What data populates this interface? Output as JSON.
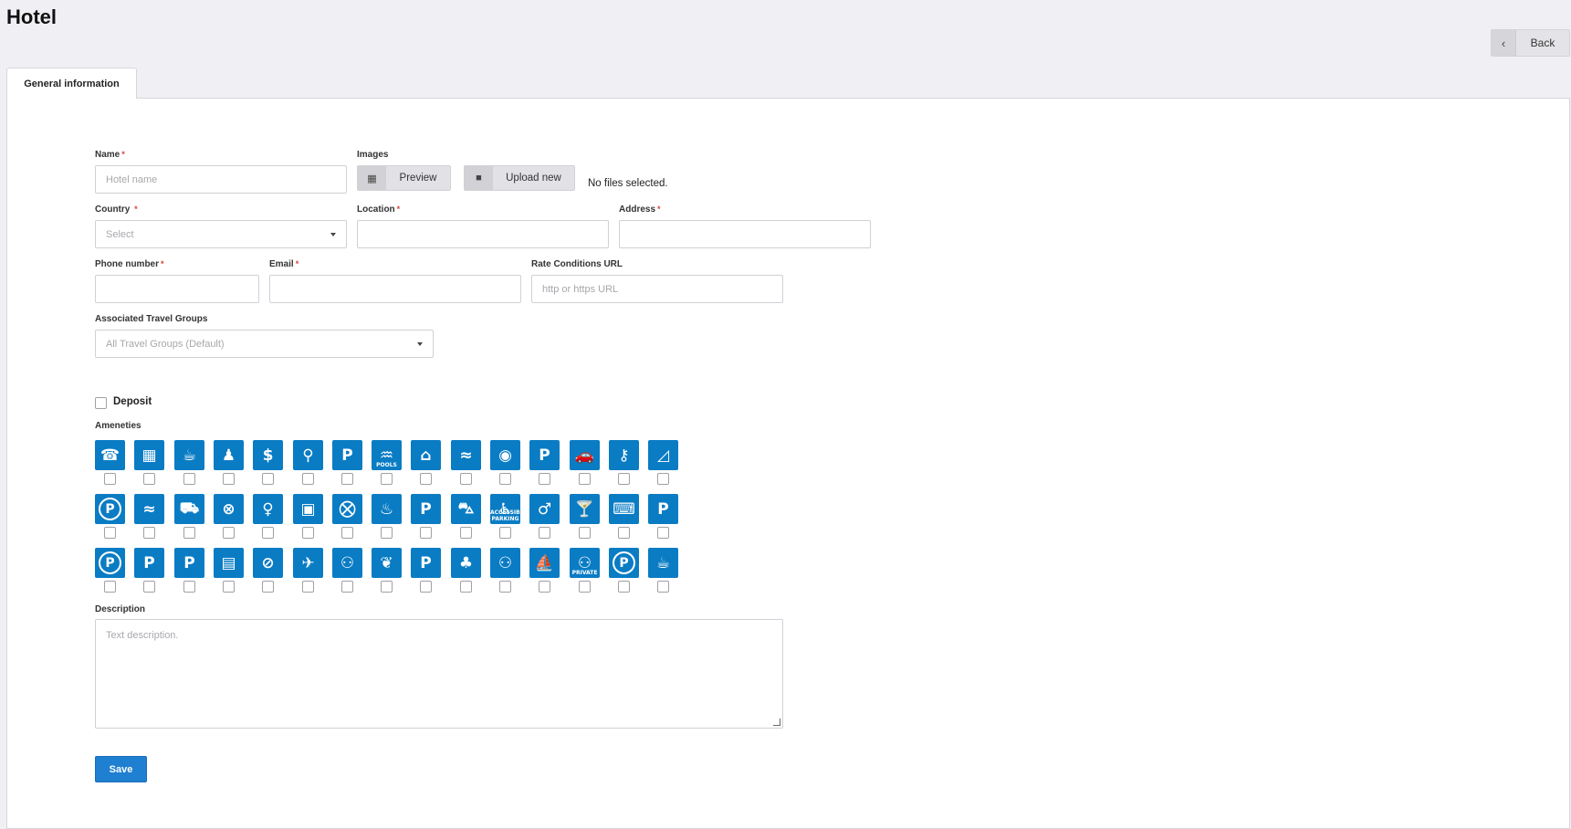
{
  "page": {
    "title": "Hotel",
    "back_label": "Back"
  },
  "tabs": [
    {
      "label": "General information"
    }
  ],
  "form": {
    "name": {
      "label": "Name",
      "required": "*",
      "placeholder": "Hotel name"
    },
    "images": {
      "label": "Images",
      "preview_label": "Preview",
      "upload_label": "Upload new",
      "status": "No files selected."
    },
    "country": {
      "label": "Country",
      "required": "*",
      "placeholder": "Select"
    },
    "location": {
      "label": "Location",
      "required": "*"
    },
    "address": {
      "label": "Address",
      "required": "*"
    },
    "phone": {
      "label": "Phone number",
      "required": "*"
    },
    "email": {
      "label": "Email",
      "required": "*"
    },
    "rate_url": {
      "label": "Rate Conditions URL",
      "placeholder": "http or https URL"
    },
    "travel_groups": {
      "label": "Associated Travel Groups",
      "value": "All Travel Groups (Default)"
    },
    "deposit": {
      "label": "Deposit",
      "checked": false
    },
    "amenities": {
      "label": "Ameneties",
      "color": "#0a7cc4",
      "icons": [
        "room-service-icon",
        "crib-icon",
        "hot-drink-icon",
        "meeting-room-icon",
        "currency-exchange-icon",
        "concierge-icon",
        "paid-parking-icon",
        "pools-icon",
        "garage-icon",
        "swimming-icon",
        "laundry-icon",
        "parking-sign-icon",
        "parking-car-icon",
        "car-key-icon",
        "beach-icon",
        "parking-circle-icon",
        "swimming-pool-icon",
        "delivery-truck-icon",
        "restaurant-icon",
        "housekeeping-icon",
        "safe-icon",
        "shopping-icon",
        "sunbathing-icon",
        "truck-parking-icon",
        "car-service-icon",
        "accessible-parking-icon",
        "doorman-icon",
        "bar-icon",
        "wifi-laptop-icon",
        "airport-parking-icon",
        "parking-circle-alt-icon",
        "parking-arrows-icon",
        "motorcycle-parking-icon",
        "bus-icon",
        "no-smoking-icon",
        "airport-shuttle-icon",
        "family-icon",
        "pet-friendly-icon",
        "valet-parking-icon",
        "tropical-icon",
        "couple-icon",
        "beach-waves-icon",
        "private-restroom-icon",
        "parking-outline-icon",
        "coffee-icon"
      ],
      "glyphs": [
        "☎",
        "▦",
        "☕",
        "♟",
        "$",
        "⚲",
        "P",
        "♒",
        "⌂",
        "≈",
        "◉",
        "P",
        "🚗",
        "⚷",
        "◿",
        "P",
        "≈",
        "⛟",
        "⊗",
        "♀",
        "▣",
        "⛒",
        "♨",
        "P",
        "⛍",
        "♿",
        "♂",
        "🍸",
        "⌨",
        "P",
        "P",
        "P",
        "P",
        "▤",
        "⊘",
        "✈",
        "⚇",
        "❦",
        "P",
        "♣",
        "⚇",
        "⛵",
        "⚇",
        "P",
        "☕"
      ],
      "small_labels": {
        "7": "POOLS",
        "25": "ACCESSIBLE PARKING",
        "42": "PRIVATE"
      }
    },
    "description": {
      "label": "Description",
      "placeholder": "Text description."
    },
    "save_label": "Save"
  }
}
